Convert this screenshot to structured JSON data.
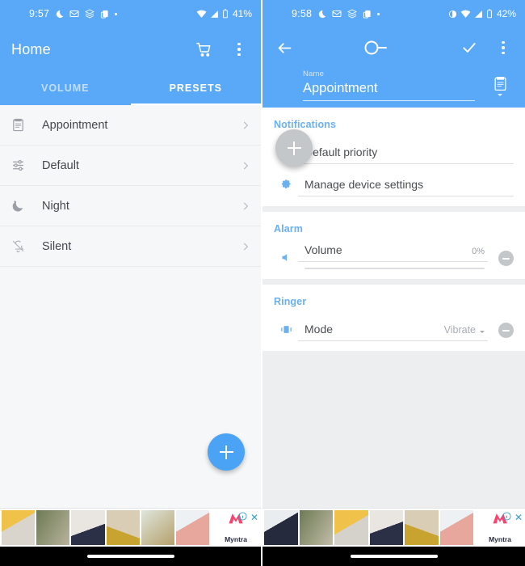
{
  "left": {
    "statusbar": {
      "time": "9:57",
      "battery": "41%",
      "icons": [
        "moon-icon",
        "mail-icon",
        "layers-icon",
        "copy-icon",
        "dot-icon"
      ],
      "right_icons": [
        "wifi-icon",
        "signal-icon",
        "battery-icon"
      ]
    },
    "appbar": {
      "title": "Home",
      "actions": [
        "cart-icon",
        "overflow-menu-icon"
      ]
    },
    "tabs": [
      {
        "label": "VOLUME",
        "active": false
      },
      {
        "label": "PRESETS",
        "active": true
      }
    ],
    "presets": [
      {
        "label": "Appointment",
        "icon": "clipboard-icon"
      },
      {
        "label": "Default",
        "icon": "tune-sliders-icon"
      },
      {
        "label": "Night",
        "icon": "moon-star-icon"
      },
      {
        "label": "Silent",
        "icon": "bell-off-icon"
      }
    ],
    "fab": {
      "icon": "plus-icon"
    }
  },
  "right": {
    "statusbar": {
      "time": "9:58",
      "battery": "42%",
      "icons": [
        "moon-icon",
        "mail-icon",
        "layers-icon",
        "copy-icon",
        "dot-icon"
      ],
      "right_icons": [
        "contrast-icon",
        "wifi-icon",
        "signal-icon",
        "battery-icon"
      ]
    },
    "appbar": {
      "back": "back-arrow-icon",
      "toggle": "toggle-switch-off",
      "confirm": "check-icon",
      "overflow": "overflow-menu-icon"
    },
    "name_field": {
      "label": "Name",
      "value": "Appointment",
      "trailing_icon": "clipboard-picker-icon"
    },
    "fab": {
      "icon": "plus-icon"
    },
    "sections": [
      {
        "title": "Notifications",
        "rows": [
          {
            "icon": "priority-exclamation-icon",
            "label": "Default priority",
            "value": "",
            "type": "field"
          },
          {
            "icon": "gear-icon",
            "label": "Manage device settings",
            "value": "",
            "type": "field"
          }
        ]
      },
      {
        "title": "Alarm",
        "rows": [
          {
            "icon": "volume-icon",
            "label": "Volume",
            "value": "0%",
            "type": "slider",
            "remove": true
          }
        ]
      },
      {
        "title": "Ringer",
        "rows": [
          {
            "icon": "vibrate-icon",
            "label": "Mode",
            "value": "Vibrate",
            "type": "dropdown",
            "remove": true
          }
        ]
      }
    ]
  },
  "ad": {
    "brand": "Myntra",
    "info_icon": "info-icon",
    "close_icon": "close-icon",
    "left_thumbs": [
      "#d8c7ae",
      "#7b8a6a",
      "#3c3f52",
      "#d8c08c",
      "#cfd9cc",
      "#e8c9c4"
    ],
    "right_thumbs": [
      "#2d3342",
      "#8a9478",
      "#c9952f",
      "#2f3445",
      "#c9a24a",
      "#e2e6ea"
    ]
  },
  "colors": {
    "accent": "#5aa9f8",
    "fab": "#4ba3f5",
    "section_title": "#6bb0ef",
    "myntra": "#ff3f6c"
  }
}
